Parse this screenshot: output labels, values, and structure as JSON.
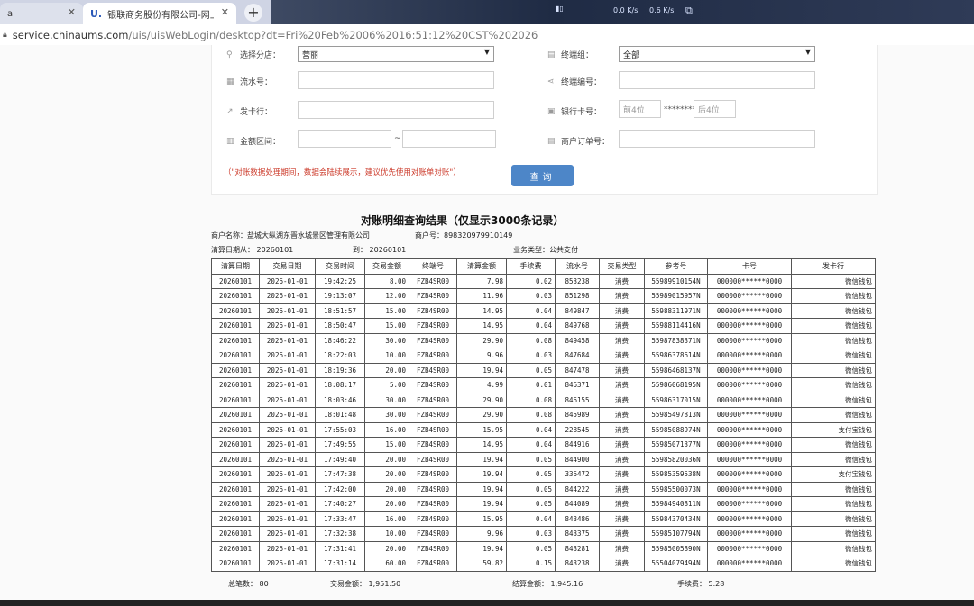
{
  "browser": {
    "tabs": [
      {
        "label": "ai",
        "active": false
      },
      {
        "label": "银联商务股份有限公司-网上服务",
        "active": true
      }
    ],
    "new_tab": "+",
    "tray": {
      "speed1": "0.0",
      "unit1": "K/s",
      "speed2": "0.6",
      "unit2": "K/s"
    },
    "url_host": "service.chinaums.com",
    "url_rest": "/uis/uisWebLogin/desktop?dt=Fri%20Feb%2006%2016:51:12%20CST%202026"
  },
  "filters": {
    "store_label": "选择分店：",
    "store_value": "营丽",
    "terminal_group_label": "终端组：",
    "terminal_group_value": "全部",
    "serial_label": "流水号：",
    "terminal_no_label": "终端编号：",
    "issuer_label": "发卡行：",
    "card_label": "银行卡号：",
    "card_first_placeholder": "前4位",
    "card_mask": "********",
    "card_last_placeholder": "后4位",
    "amount_label": "金额区间：",
    "amount_sep": "~",
    "order_label": "商户订单号：",
    "notice": "（\"对账数据处理期间，数据会陆续展示，建议优先使用对账单对账\"）",
    "query_button": "查询"
  },
  "report": {
    "title": "对账明细查询结果（仅显示3000条记录）",
    "merchant_name": "商户名称：盐城大纵湖东晋水城景区管理有限公司",
    "merchant_no": "商户号：898320979910149",
    "settle_from": "清算日期从：  20260101",
    "settle_to": "到：  20260101",
    "biz_type": "业务类型：公共支付",
    "columns": [
      "清算日期",
      "交易日期",
      "交易时间",
      "交易金额",
      "终端号",
      "清算金额",
      "手续费",
      "流水号",
      "交易类型",
      "参考号",
      "卡号",
      "发卡行"
    ],
    "rows": [
      [
        "20260101",
        "2026-01-01",
        "19:42:25",
        "8.00",
        "FZB4SR00",
        "7.98",
        "0.02",
        "853238",
        "消费",
        "55989910154N",
        "000000******0000",
        "微信钱包"
      ],
      [
        "20260101",
        "2026-01-01",
        "19:13:07",
        "12.00",
        "FZB4SR00",
        "11.96",
        "0.03",
        "851298",
        "消费",
        "55989015957N",
        "000000******0000",
        "微信钱包"
      ],
      [
        "20260101",
        "2026-01-01",
        "18:51:57",
        "15.00",
        "FZB4SR00",
        "14.95",
        "0.04",
        "849847",
        "消费",
        "55988311971N",
        "000000******0000",
        "微信钱包"
      ],
      [
        "20260101",
        "2026-01-01",
        "18:50:47",
        "15.00",
        "FZB4SR00",
        "14.95",
        "0.04",
        "849768",
        "消费",
        "55988114416N",
        "000000******0000",
        "微信钱包"
      ],
      [
        "20260101",
        "2026-01-01",
        "18:46:22",
        "30.00",
        "FZB4SR00",
        "29.90",
        "0.08",
        "849458",
        "消费",
        "55987838371N",
        "000000******0000",
        "微信钱包"
      ],
      [
        "20260101",
        "2026-01-01",
        "18:22:03",
        "10.00",
        "FZB4SR00",
        "9.96",
        "0.03",
        "847684",
        "消费",
        "55986378614N",
        "000000******0000",
        "微信钱包"
      ],
      [
        "20260101",
        "2026-01-01",
        "18:19:36",
        "20.00",
        "FZB4SR00",
        "19.94",
        "0.05",
        "847478",
        "消费",
        "55986468137N",
        "000000******0000",
        "微信钱包"
      ],
      [
        "20260101",
        "2026-01-01",
        "18:08:17",
        "5.00",
        "FZB4SR00",
        "4.99",
        "0.01",
        "846371",
        "消费",
        "55986068195N",
        "000000******0000",
        "微信钱包"
      ],
      [
        "20260101",
        "2026-01-01",
        "18:03:46",
        "30.00",
        "FZB4SR00",
        "29.90",
        "0.08",
        "846155",
        "消费",
        "55986317015N",
        "000000******0000",
        "微信钱包"
      ],
      [
        "20260101",
        "2026-01-01",
        "18:01:48",
        "30.00",
        "FZB4SR00",
        "29.90",
        "0.08",
        "845989",
        "消费",
        "55985497813N",
        "000000******0000",
        "微信钱包"
      ],
      [
        "20260101",
        "2026-01-01",
        "17:55:03",
        "16.00",
        "FZB4SR00",
        "15.95",
        "0.04",
        "228545",
        "消费",
        "55985088974N",
        "000000******0000",
        "支付宝钱包"
      ],
      [
        "20260101",
        "2026-01-01",
        "17:49:55",
        "15.00",
        "FZB4SR00",
        "14.95",
        "0.04",
        "844916",
        "消费",
        "55985071377N",
        "000000******0000",
        "微信钱包"
      ],
      [
        "20260101",
        "2026-01-01",
        "17:49:40",
        "20.00",
        "FZB4SR00",
        "19.94",
        "0.05",
        "844900",
        "消费",
        "55985820036N",
        "000000******0000",
        "微信钱包"
      ],
      [
        "20260101",
        "2026-01-01",
        "17:47:38",
        "20.00",
        "FZB4SR00",
        "19.94",
        "0.05",
        "336472",
        "消费",
        "55985359538N",
        "000000******0000",
        "支付宝钱包"
      ],
      [
        "20260101",
        "2026-01-01",
        "17:42:00",
        "20.00",
        "FZB4SR00",
        "19.94",
        "0.05",
        "844222",
        "消费",
        "55985500073N",
        "000000******0000",
        "微信钱包"
      ],
      [
        "20260101",
        "2026-01-01",
        "17:40:27",
        "20.00",
        "FZB4SR00",
        "19.94",
        "0.05",
        "844089",
        "消费",
        "55984940811N",
        "000000******0000",
        "微信钱包"
      ],
      [
        "20260101",
        "2026-01-01",
        "17:33:47",
        "16.00",
        "FZB4SR00",
        "15.95",
        "0.04",
        "843486",
        "消费",
        "55984370434N",
        "000000******0000",
        "微信钱包"
      ],
      [
        "20260101",
        "2026-01-01",
        "17:32:38",
        "10.00",
        "FZB4SR00",
        "9.96",
        "0.03",
        "843375",
        "消费",
        "55985107794N",
        "000000******0000",
        "微信钱包"
      ],
      [
        "20260101",
        "2026-01-01",
        "17:31:41",
        "20.00",
        "FZB4SR00",
        "19.94",
        "0.05",
        "843281",
        "消费",
        "55985005890N",
        "000000******0000",
        "微信钱包"
      ],
      [
        "20260101",
        "2026-01-01",
        "17:31:14",
        "60.00",
        "FZB4SR00",
        "59.82",
        "0.15",
        "843238",
        "消费",
        "55504079494N",
        "000000******0000",
        "微信钱包"
      ]
    ],
    "total_count": "总笔数：  80",
    "total_trade": "交易金额：  1,951.50",
    "total_settle": "结算金额：  1,945.16",
    "total_fee": "手续费：  5.28"
  }
}
